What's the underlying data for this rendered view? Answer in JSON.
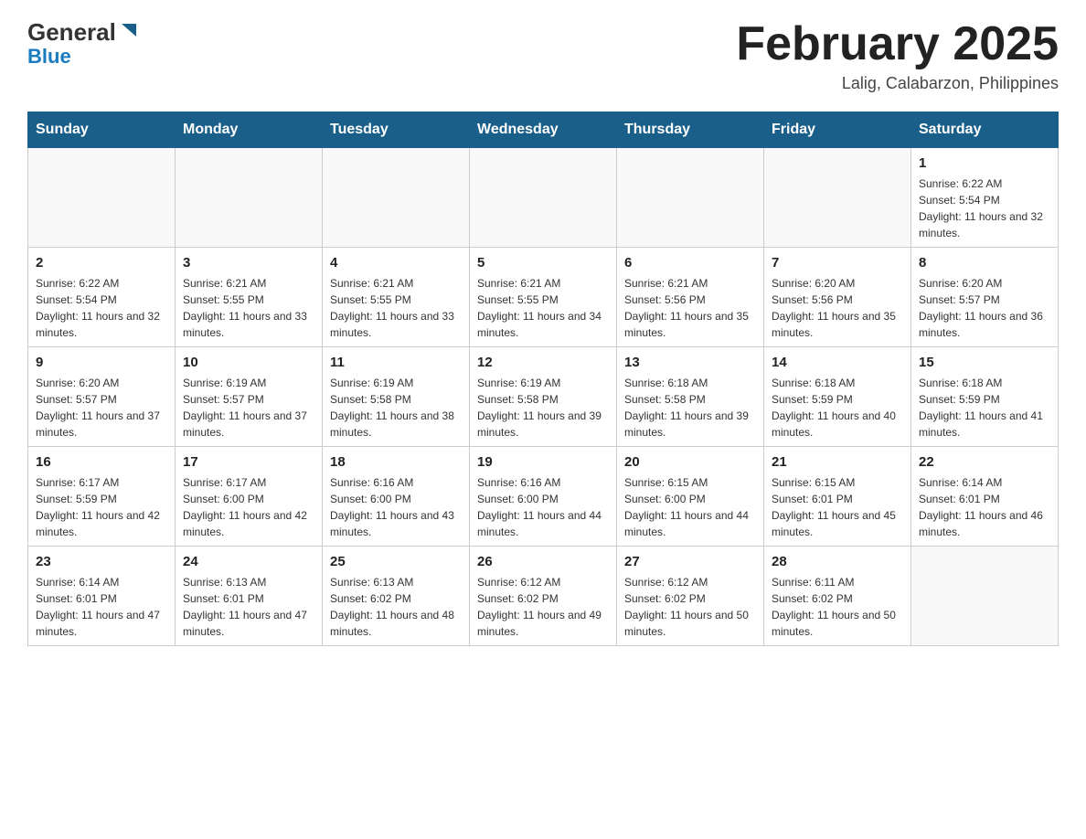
{
  "header": {
    "logo_general": "General",
    "logo_blue": "Blue",
    "month_title": "February 2025",
    "location": "Lalig, Calabarzon, Philippines"
  },
  "days_of_week": [
    "Sunday",
    "Monday",
    "Tuesday",
    "Wednesday",
    "Thursday",
    "Friday",
    "Saturday"
  ],
  "weeks": [
    [
      {
        "day": "",
        "info": ""
      },
      {
        "day": "",
        "info": ""
      },
      {
        "day": "",
        "info": ""
      },
      {
        "day": "",
        "info": ""
      },
      {
        "day": "",
        "info": ""
      },
      {
        "day": "",
        "info": ""
      },
      {
        "day": "1",
        "info": "Sunrise: 6:22 AM\nSunset: 5:54 PM\nDaylight: 11 hours and 32 minutes."
      }
    ],
    [
      {
        "day": "2",
        "info": "Sunrise: 6:22 AM\nSunset: 5:54 PM\nDaylight: 11 hours and 32 minutes."
      },
      {
        "day": "3",
        "info": "Sunrise: 6:21 AM\nSunset: 5:55 PM\nDaylight: 11 hours and 33 minutes."
      },
      {
        "day": "4",
        "info": "Sunrise: 6:21 AM\nSunset: 5:55 PM\nDaylight: 11 hours and 33 minutes."
      },
      {
        "day": "5",
        "info": "Sunrise: 6:21 AM\nSunset: 5:55 PM\nDaylight: 11 hours and 34 minutes."
      },
      {
        "day": "6",
        "info": "Sunrise: 6:21 AM\nSunset: 5:56 PM\nDaylight: 11 hours and 35 minutes."
      },
      {
        "day": "7",
        "info": "Sunrise: 6:20 AM\nSunset: 5:56 PM\nDaylight: 11 hours and 35 minutes."
      },
      {
        "day": "8",
        "info": "Sunrise: 6:20 AM\nSunset: 5:57 PM\nDaylight: 11 hours and 36 minutes."
      }
    ],
    [
      {
        "day": "9",
        "info": "Sunrise: 6:20 AM\nSunset: 5:57 PM\nDaylight: 11 hours and 37 minutes."
      },
      {
        "day": "10",
        "info": "Sunrise: 6:19 AM\nSunset: 5:57 PM\nDaylight: 11 hours and 37 minutes."
      },
      {
        "day": "11",
        "info": "Sunrise: 6:19 AM\nSunset: 5:58 PM\nDaylight: 11 hours and 38 minutes."
      },
      {
        "day": "12",
        "info": "Sunrise: 6:19 AM\nSunset: 5:58 PM\nDaylight: 11 hours and 39 minutes."
      },
      {
        "day": "13",
        "info": "Sunrise: 6:18 AM\nSunset: 5:58 PM\nDaylight: 11 hours and 39 minutes."
      },
      {
        "day": "14",
        "info": "Sunrise: 6:18 AM\nSunset: 5:59 PM\nDaylight: 11 hours and 40 minutes."
      },
      {
        "day": "15",
        "info": "Sunrise: 6:18 AM\nSunset: 5:59 PM\nDaylight: 11 hours and 41 minutes."
      }
    ],
    [
      {
        "day": "16",
        "info": "Sunrise: 6:17 AM\nSunset: 5:59 PM\nDaylight: 11 hours and 42 minutes."
      },
      {
        "day": "17",
        "info": "Sunrise: 6:17 AM\nSunset: 6:00 PM\nDaylight: 11 hours and 42 minutes."
      },
      {
        "day": "18",
        "info": "Sunrise: 6:16 AM\nSunset: 6:00 PM\nDaylight: 11 hours and 43 minutes."
      },
      {
        "day": "19",
        "info": "Sunrise: 6:16 AM\nSunset: 6:00 PM\nDaylight: 11 hours and 44 minutes."
      },
      {
        "day": "20",
        "info": "Sunrise: 6:15 AM\nSunset: 6:00 PM\nDaylight: 11 hours and 44 minutes."
      },
      {
        "day": "21",
        "info": "Sunrise: 6:15 AM\nSunset: 6:01 PM\nDaylight: 11 hours and 45 minutes."
      },
      {
        "day": "22",
        "info": "Sunrise: 6:14 AM\nSunset: 6:01 PM\nDaylight: 11 hours and 46 minutes."
      }
    ],
    [
      {
        "day": "23",
        "info": "Sunrise: 6:14 AM\nSunset: 6:01 PM\nDaylight: 11 hours and 47 minutes."
      },
      {
        "day": "24",
        "info": "Sunrise: 6:13 AM\nSunset: 6:01 PM\nDaylight: 11 hours and 47 minutes."
      },
      {
        "day": "25",
        "info": "Sunrise: 6:13 AM\nSunset: 6:02 PM\nDaylight: 11 hours and 48 minutes."
      },
      {
        "day": "26",
        "info": "Sunrise: 6:12 AM\nSunset: 6:02 PM\nDaylight: 11 hours and 49 minutes."
      },
      {
        "day": "27",
        "info": "Sunrise: 6:12 AM\nSunset: 6:02 PM\nDaylight: 11 hours and 50 minutes."
      },
      {
        "day": "28",
        "info": "Sunrise: 6:11 AM\nSunset: 6:02 PM\nDaylight: 11 hours and 50 minutes."
      },
      {
        "day": "",
        "info": ""
      }
    ]
  ]
}
